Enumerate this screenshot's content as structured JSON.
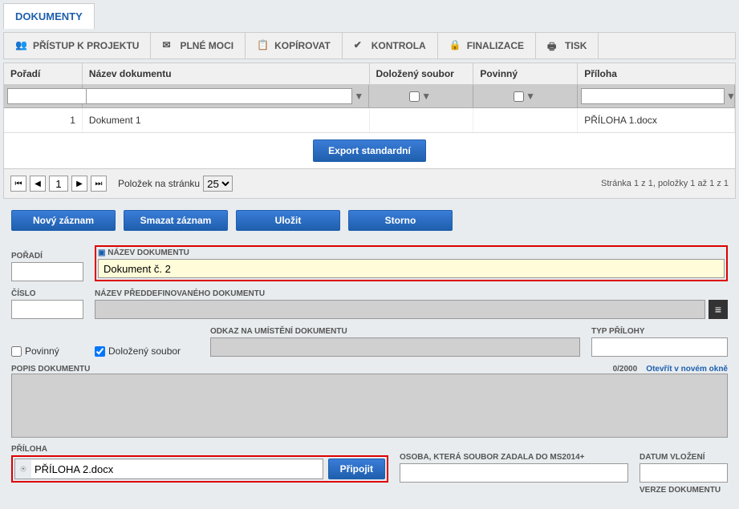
{
  "tab": {
    "label": "DOKUMENTY"
  },
  "toolbar": [
    {
      "label": "PŘÍSTUP K PROJEKTU",
      "icon": "people"
    },
    {
      "label": "PLNÉ MOCI",
      "icon": "mail"
    },
    {
      "label": "KOPÍROVAT",
      "icon": "copy"
    },
    {
      "label": "KONTROLA",
      "icon": "check"
    },
    {
      "label": "FINALIZACE",
      "icon": "lock"
    },
    {
      "label": "TISK",
      "icon": "print"
    }
  ],
  "table": {
    "headers": {
      "poradi": "Pořadí",
      "nazev": "Název dokumentu",
      "dolozeny": "Doložený soubor",
      "povinny": "Povinný",
      "priloha": "Příloha"
    },
    "rows": [
      {
        "poradi": "1",
        "nazev": "Dokument 1",
        "dolozeny": "",
        "povinny": "",
        "priloha": "PŘÍLOHA 1.docx"
      }
    ],
    "export": "Export standardní",
    "pager": {
      "page": "1",
      "items_label": "Položek na stránku",
      "items_per_page": "25",
      "info": "Stránka 1 z 1, položky 1 až 1 z 1"
    }
  },
  "actions": {
    "novy": "Nový záznam",
    "smazat": "Smazat záznam",
    "ulozit": "Uložit",
    "storno": "Storno"
  },
  "form": {
    "poradi": {
      "label": "POŘADÍ",
      "value": ""
    },
    "nazev": {
      "label": "NÁZEV DOKUMENTU",
      "value": "Dokument č. 2"
    },
    "cislo": {
      "label": "ČÍSLO",
      "value": ""
    },
    "preddef": {
      "label": "NÁZEV PŘEDDEFINOVANÉHO DOKUMENTU",
      "value": ""
    },
    "povinny": {
      "label": "Povinný"
    },
    "dolozeny": {
      "label": "Doložený soubor"
    },
    "odkaz": {
      "label": "ODKAZ NA UMÍSTĚNÍ DOKUMENTU",
      "value": ""
    },
    "typ": {
      "label": "TYP PŘÍLOHY",
      "value": ""
    },
    "popis": {
      "label": "POPIS DOKUMENTU",
      "counter": "0/2000",
      "link": "Otevřít v novém okně"
    },
    "priloha": {
      "label": "PŘÍLOHA",
      "value": "PŘÍLOHA 2.docx",
      "btn": "Připojit"
    },
    "osoba": {
      "label": "OSOBA, KTERÁ SOUBOR ZADALA DO MS2014+",
      "value": ""
    },
    "datum": {
      "label": "DATUM VLOŽENÍ",
      "value": ""
    },
    "verze": {
      "label": "VERZE DOKUMENTU"
    }
  }
}
